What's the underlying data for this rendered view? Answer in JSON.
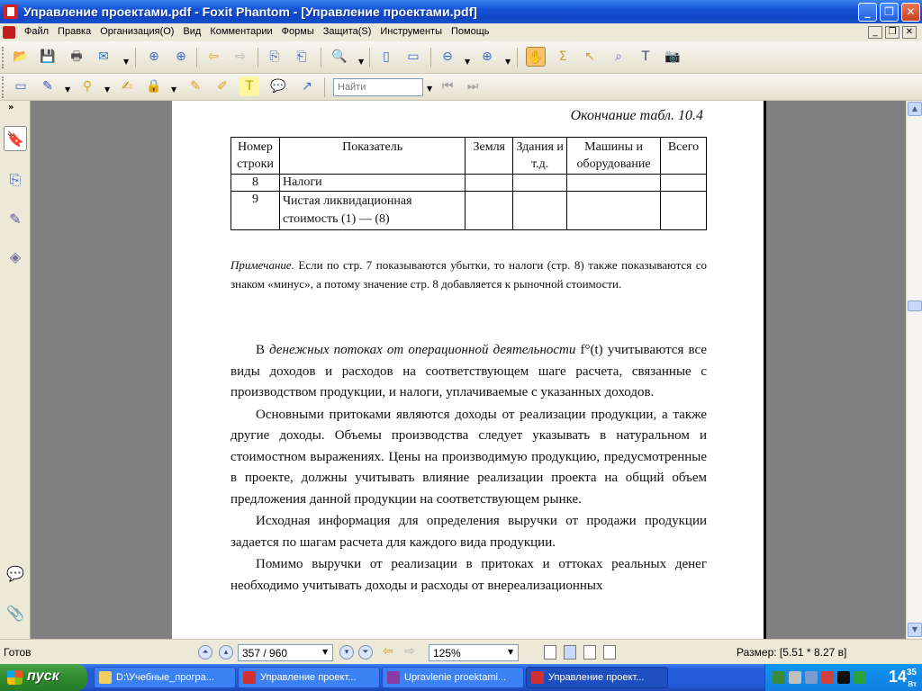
{
  "window": {
    "title": "Управление проектами.pdf - Foxit Phantom - [Управление проектами.pdf]"
  },
  "menu": [
    "Файл",
    "Правка",
    "Организация(O)",
    "Вид",
    "Комментарии",
    "Формы",
    "Защита(S)",
    "Инструменты",
    "Помощь"
  ],
  "toolbar": {
    "find_placeholder": "Найти"
  },
  "document": {
    "table_caption": "Окончание табл. 10.4",
    "table": {
      "headers": [
        "Номер строки",
        "Показатель",
        "Земля",
        "Здания и т.д.",
        "Машины и оборудование",
        "Всего"
      ],
      "rows": [
        {
          "num": "8",
          "label": "Налоги"
        },
        {
          "num": "9",
          "label": "Чистая ликвидационная стоимость (1) — (8)"
        }
      ]
    },
    "note_lead": "Примечание.",
    "note_text": " Если по стр. 7 показываются убытки, то налоги (стр. 8) также показываются со знаком «минус», а потому значение стр. 8 добавляется к рыночной стоимости.",
    "p1_a": "В ",
    "p1_em": "денежных потоках от операционной деятельности",
    "p1_b": " f°(t) учитываются все виды доходов и расходов на соответствующем шаге расчета, связанные с производством продукции, и налоги, уплачиваемые с указанных доходов.",
    "p2": "Основными притоками являются доходы от реализации продукции, а также другие доходы. Объемы производства следует указывать в натуральном и стоимостном выражениях. Цены на производимую продукцию, предусмотренные в проекте, должны учитывать влияние реализации проекта на общий объем предложения данной продукции на соответствующем рынке.",
    "p3": "Исходная информация для определения выручки от продажи продукции задается по шагам расчета для каждого вида продукции.",
    "p4": "Помимо выручки от реализации в притоках и оттоках реальных денег необходимо учитывать доходы и расходы от внереализационных"
  },
  "status": {
    "ready": "Готов",
    "page": "357 / 960",
    "zoom": "125%",
    "size": "Размер: [5.51 * 8.27 в]"
  },
  "taskbar": {
    "start": "пуск",
    "tasks": [
      "D:\\Учебные_програ...",
      "Управление проект...",
      "Upravlenie proektami...",
      "Управление проект..."
    ],
    "clock_hour": "14",
    "clock_min": "35",
    "weekday": "Вт"
  }
}
